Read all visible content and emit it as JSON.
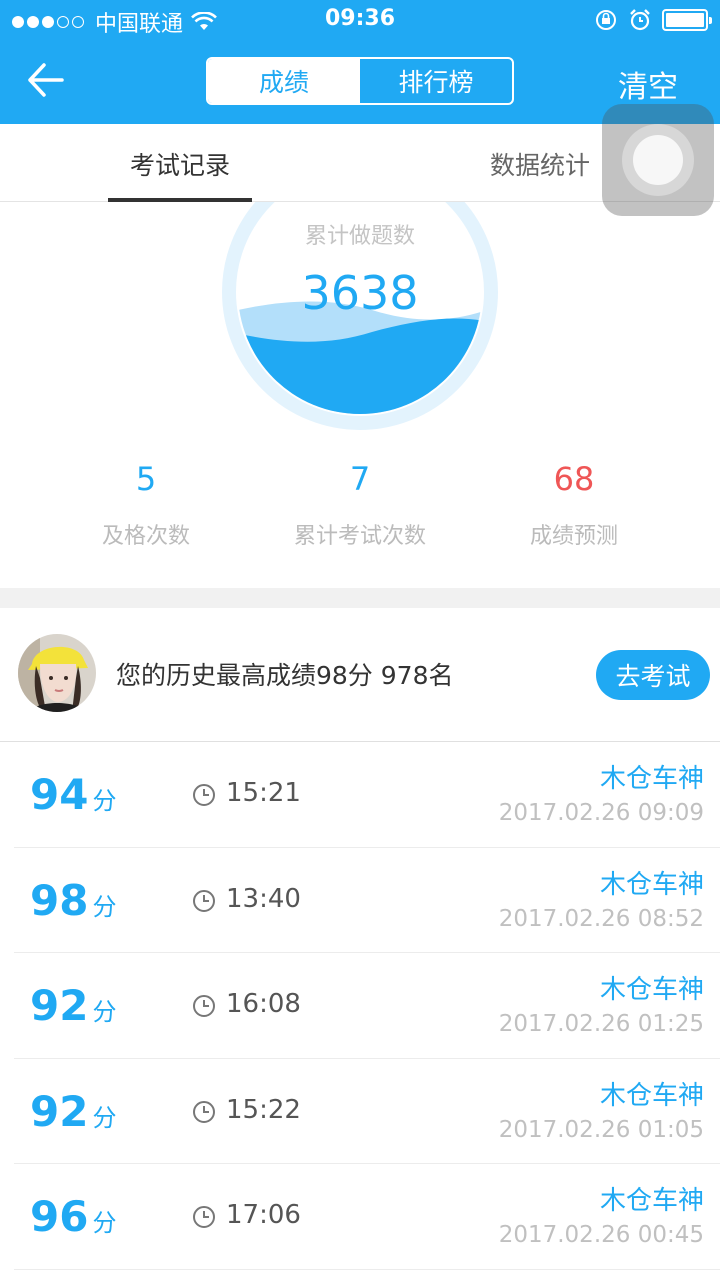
{
  "status_bar": {
    "carrier": "中国联通",
    "time": "09:36"
  },
  "nav": {
    "tab_scores": "成绩",
    "tab_ranking": "排行榜",
    "clear": "清空"
  },
  "sub_tabs": {
    "records": "考试记录",
    "statistics": "数据统计"
  },
  "gauge": {
    "label": "累计做题数",
    "value": "3638"
  },
  "stats": [
    {
      "value": "5",
      "label": "及格次数"
    },
    {
      "value": "7",
      "label": "累计考试次数"
    },
    {
      "value": "68",
      "label": "成绩预测"
    }
  ],
  "best": {
    "text": "您的历史最高成绩98分 978名",
    "button": "去考试"
  },
  "records": [
    {
      "score": "94",
      "unit": "分",
      "duration": "15:21",
      "name": "木仓车神",
      "date": "2017.02.26 09:09"
    },
    {
      "score": "98",
      "unit": "分",
      "duration": "13:40",
      "name": "木仓车神",
      "date": "2017.02.26 08:52"
    },
    {
      "score": "92",
      "unit": "分",
      "duration": "16:08",
      "name": "木仓车神",
      "date": "2017.02.26 01:25"
    },
    {
      "score": "92",
      "unit": "分",
      "duration": "15:22",
      "name": "木仓车神",
      "date": "2017.02.26 01:05"
    },
    {
      "score": "96",
      "unit": "分",
      "duration": "17:06",
      "name": "木仓车神",
      "date": "2017.02.26 00:45"
    }
  ],
  "colors": {
    "primary": "#20a9f3",
    "accent_red": "#ef5656"
  }
}
